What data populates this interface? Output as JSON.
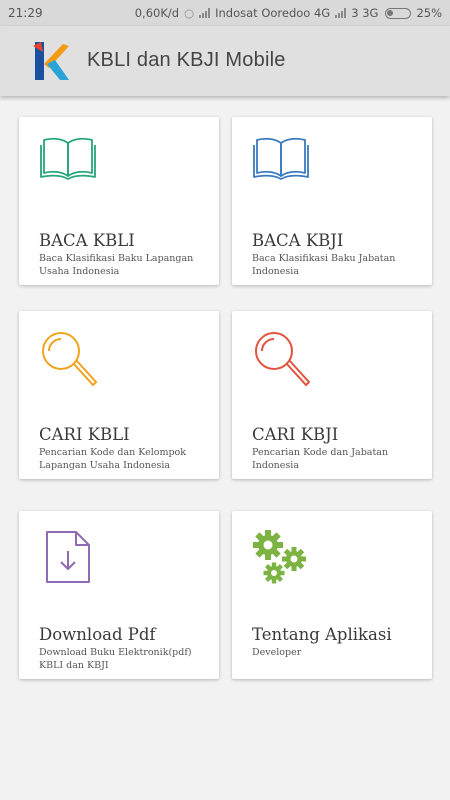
{
  "status_bar": {
    "time": "21:29",
    "speed": "0,60K/d",
    "carrier": "Indosat Ooredoo 4G",
    "network2": "3 3G",
    "battery": "25%"
  },
  "app_bar": {
    "title": "KBLI dan KBJI Mobile",
    "logo_icon": "k-logo-icon",
    "logo_colors": [
      "#1b4fa0",
      "#e8412c",
      "#f39c12",
      "#2aa3d8"
    ]
  },
  "menu": [
    {
      "title": "BACA KBLI",
      "description": "Baca Klasifikasi Baku Lapangan Usaha Indonesia",
      "icon": "book-open-icon",
      "color": "#26a67a"
    },
    {
      "title": "BACA KBJI",
      "description": "Baca Klasifikasi Baku Jabatan Indonesia",
      "icon": "book-open-icon",
      "color": "#3a7bbf"
    },
    {
      "title": "CARI KBLI",
      "description": "Pencarian Kode dan Kelompok Lapangan Usaha Indonesia",
      "icon": "magnifier-icon",
      "color": "#f0a320"
    },
    {
      "title": "CARI KBJI",
      "description": "Pencarian Kode dan Jabatan Indonesia",
      "icon": "magnifier-icon",
      "color": "#e4533f"
    },
    {
      "title": "Download Pdf",
      "description": "Download Buku Elektronik(pdf) KBLI dan KBJI",
      "icon": "download-file-icon",
      "color": "#8e6bb3"
    },
    {
      "title": "Tentang Aplikasi",
      "description": "Developer",
      "icon": "gears-icon",
      "color": "#7cb342"
    }
  ]
}
